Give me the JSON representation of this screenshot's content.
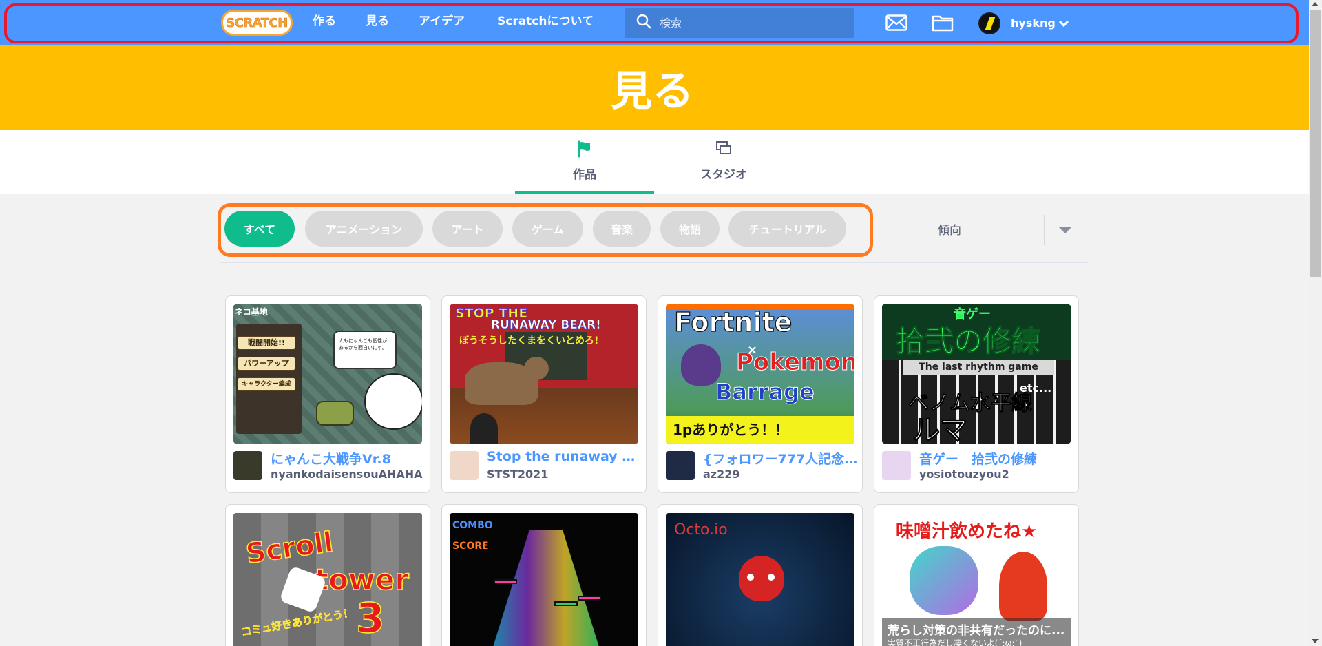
{
  "nav": {
    "logo_text": "SCRATCH",
    "links": [
      "作る",
      "見る",
      "アイデア",
      "Scratchについて"
    ],
    "search_placeholder": "検索",
    "username": "hyskng",
    "icons": [
      "messages-icon",
      "my-stuff-folder-icon"
    ]
  },
  "banner": {
    "title": "見る"
  },
  "tabs": [
    {
      "label": "作品",
      "icon": "flag-icon",
      "active": true
    },
    {
      "label": "スタジオ",
      "icon": "studio-icon",
      "active": false
    }
  ],
  "filters": {
    "categories": [
      "すべて",
      "アニメーション",
      "アート",
      "ゲーム",
      "音楽",
      "物語",
      "チュートリアル"
    ],
    "selected": "すべて",
    "sort_label": "傾向"
  },
  "colors": {
    "nav_blue": "#4c97ff",
    "banner_yellow": "#ffbf00",
    "active_green": "#0fbd8c",
    "link_blue": "#4c97ff",
    "annotation_red": "#e8192c",
    "annotation_orange": "#ff7a21"
  },
  "projects": [
    {
      "title": "にゃんこ大戦争Vr.8",
      "author": "nyankodaisensouAHAHA",
      "thumb_text": [
        "ネコ基地",
        "戦闘開始!!",
        "パワーアップ",
        "キャラクター編成",
        "人もにゃんこも個性があるから面白いにゃ。"
      ]
    },
    {
      "title": "Stop the runaway be...",
      "author": "STST2021",
      "thumb_text": [
        "STOP THE",
        "RUNAWAY BEAR!",
        "ぼうそうしたくまをくいとめろ!"
      ]
    },
    {
      "title": "{フォロワー777人記念...",
      "author": "az229",
      "thumb_text": [
        "Fortnite",
        "×",
        "Pokemon",
        "Barrage",
        "1pありがとう！！"
      ]
    },
    {
      "title": "音ゲー　拾弐の修練",
      "author": "yosiotouzyou2",
      "thumb_text": [
        "音ゲー",
        "拾弐の修練",
        "The last rhythm game",
        "ベノム水平線",
        "ルマ",
        "etc..."
      ]
    },
    {
      "title": "",
      "author": "",
      "thumb_text": [
        "Scroll",
        "tower",
        "3",
        "コミュ好きありがとう！"
      ]
    },
    {
      "title": "",
      "author": "",
      "thumb_text": [
        "COMBO",
        "SCORE"
      ]
    },
    {
      "title": "",
      "author": "",
      "thumb_text": [
        "Octo.io"
      ]
    },
    {
      "title": "",
      "author": "",
      "thumb_text": [
        "味噌汁飲めたね★",
        "荒らし対策の非共有だったのに...",
        "実質不正行為だし凄くないよ(´;ω;`)"
      ]
    }
  ]
}
